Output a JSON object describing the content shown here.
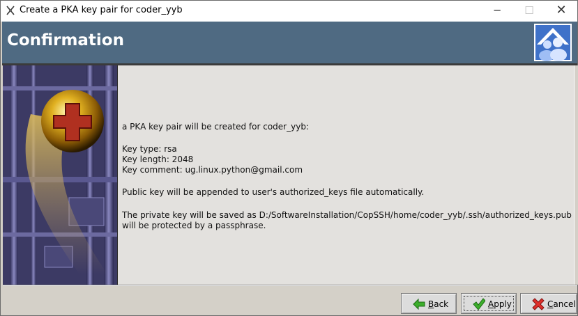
{
  "window": {
    "title": "Create a PKA key pair for coder_yyb",
    "controls": {
      "minimize": "─",
      "maximize": "☐",
      "close": "✕"
    }
  },
  "header": {
    "title": "Confirmation"
  },
  "content": {
    "intro": "a PKA key pair will be created for coder_yyb:",
    "key_type": "Key type: rsa",
    "key_length": "Key length: 2048",
    "key_comment": "Key comment: ug.linux.python@gmail.com",
    "public_key_note": "Public key will be appended to user's authorized_keys file automatically.",
    "private_key_line1": "The private key will be saved as D:/SoftwareInstallation/CopSSH/home/coder_yyb/.ssh/authorized_keys.pub and",
    "private_key_line2": "will  be protected by a passphrase."
  },
  "buttons": {
    "back": {
      "label": "Back",
      "icon": "green-left-arrow-icon"
    },
    "apply": {
      "label": "Apply",
      "icon": "green-checkmark-icon"
    },
    "cancel": {
      "label": "Cancel",
      "icon": "red-x-icon"
    }
  },
  "colors": {
    "header_bg": "#4f6a82",
    "content_bg": "#e3e1de",
    "side_image_bg": "#3c3a64"
  }
}
